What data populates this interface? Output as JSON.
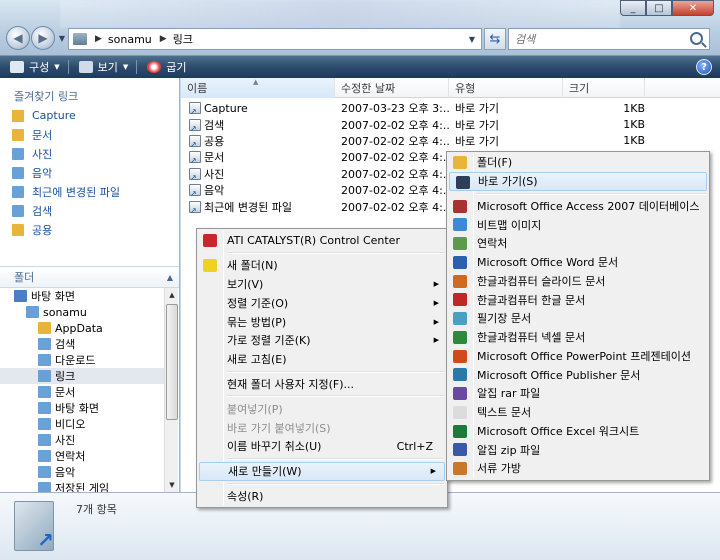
{
  "window": {
    "buttons": [
      "_",
      "□",
      "✕"
    ]
  },
  "address": {
    "crumbs": [
      "sonamu",
      "링크"
    ],
    "search_placeholder": "검색"
  },
  "toolbar": {
    "organize": "구성",
    "views": "보기",
    "burn": "굽기",
    "help": "?"
  },
  "sidebar": {
    "favorites_title": "즐겨찾기 링크",
    "favorites": [
      {
        "label": "Capture",
        "icon": "folder-icon",
        "color": "#e8b43a"
      },
      {
        "label": "문서",
        "icon": "documents-icon",
        "color": "#e8b43a"
      },
      {
        "label": "사진",
        "icon": "pictures-icon",
        "color": "#6aa0d8"
      },
      {
        "label": "음악",
        "icon": "music-icon",
        "color": "#6aa0d8"
      },
      {
        "label": "최근에 변경된 파일",
        "icon": "recent-icon",
        "color": "#6aa0d8"
      },
      {
        "label": "검색",
        "icon": "search-folder-icon",
        "color": "#6aa0d8"
      },
      {
        "label": "공용",
        "icon": "public-icon",
        "color": "#e8b43a"
      }
    ],
    "folders_title": "폴더",
    "tree": [
      {
        "label": "바탕 화면",
        "indent": 1,
        "color": "#4a7fc4"
      },
      {
        "label": "sonamu",
        "indent": 2,
        "color": "#6aa0d8"
      },
      {
        "label": "AppData",
        "indent": 3,
        "color": "#e8b43a"
      },
      {
        "label": "검색",
        "indent": 3,
        "color": "#6aa0d8"
      },
      {
        "label": "다운로드",
        "indent": 3,
        "color": "#6aa0d8"
      },
      {
        "label": "링크",
        "indent": 3,
        "color": "#6aa0d8",
        "selected": true
      },
      {
        "label": "문서",
        "indent": 3,
        "color": "#6aa0d8"
      },
      {
        "label": "바탕 화면",
        "indent": 3,
        "color": "#6aa0d8"
      },
      {
        "label": "비디오",
        "indent": 3,
        "color": "#6aa0d8"
      },
      {
        "label": "사진",
        "indent": 3,
        "color": "#6aa0d8"
      },
      {
        "label": "연락처",
        "indent": 3,
        "color": "#6aa0d8"
      },
      {
        "label": "음악",
        "indent": 3,
        "color": "#6aa0d8"
      },
      {
        "label": "저장된 게임",
        "indent": 3,
        "color": "#6aa0d8"
      }
    ]
  },
  "columns": [
    "이름",
    "수정한 날짜",
    "유형",
    "크기"
  ],
  "files": [
    {
      "name": "Capture",
      "date": "2007-03-23 오후 3:...",
      "type": "바로 가기",
      "size": "1KB"
    },
    {
      "name": "검색",
      "date": "2007-02-02 오후 4:...",
      "type": "바로 가기",
      "size": "1KB"
    },
    {
      "name": "공용",
      "date": "2007-02-02 오후 4:...",
      "type": "바로 가기",
      "size": "1KB"
    },
    {
      "name": "문서",
      "date": "2007-02-02 오후 4:...",
      "type": "",
      "size": ""
    },
    {
      "name": "사진",
      "date": "2007-02-02 오후 4:...",
      "type": "",
      "size": ""
    },
    {
      "name": "음악",
      "date": "2007-02-02 오후 4:...",
      "type": "",
      "size": ""
    },
    {
      "name": "최근에 변경된 파일",
      "date": "2007-02-02 오후 4:...",
      "type": "",
      "size": ""
    }
  ],
  "status": {
    "count": "7개 항목"
  },
  "context_menu": {
    "items": [
      {
        "label": "ATI CATALYST(R) Control Center",
        "icon": "ati-icon",
        "color": "#c8262b"
      },
      {
        "sep": true
      },
      {
        "label": "새 폴더(N)",
        "icon": "new-folder-icon",
        "color": "#f0d020"
      },
      {
        "label": "보기(V)",
        "sub": true
      },
      {
        "label": "정렬 기준(O)",
        "sub": true
      },
      {
        "label": "묶는 방법(P)",
        "sub": true
      },
      {
        "label": "가로 정렬 기준(K)",
        "sub": true
      },
      {
        "label": "새로 고침(E)"
      },
      {
        "sep": true
      },
      {
        "label": "현재 폴더 사용자 지정(F)..."
      },
      {
        "sep": true
      },
      {
        "label": "붙여넣기(P)",
        "disabled": true
      },
      {
        "label": "바로 가기 붙여넣기(S)",
        "disabled": true
      },
      {
        "label": "이름 바꾸기 취소(U)",
        "shortcut": "Ctrl+Z"
      },
      {
        "sep": true
      },
      {
        "label": "새로 만들기(W)",
        "sub": true,
        "highlight": true
      },
      {
        "sep": true
      },
      {
        "label": "속성(R)"
      }
    ]
  },
  "new_menu": {
    "items": [
      {
        "label": "폴더(F)",
        "icon": "folder-icon",
        "color": "#e8b43a"
      },
      {
        "label": "바로 가기(S)",
        "icon": "shortcut-icon",
        "color": "#2c3e5a",
        "highlight": true
      },
      {
        "sep": true
      },
      {
        "label": "Microsoft Office Access 2007 데이터베이스",
        "icon": "access-icon",
        "color": "#a83232"
      },
      {
        "label": "비트맵 이미지",
        "icon": "bitmap-icon",
        "color": "#3b8ad8"
      },
      {
        "label": "연락처",
        "icon": "contact-icon",
        "color": "#5a9a4a"
      },
      {
        "label": "Microsoft Office Word 문서",
        "icon": "word-icon",
        "color": "#2b5fb0"
      },
      {
        "label": "한글과컴퓨터 슬라이드 문서",
        "icon": "slide-icon",
        "color": "#d06a20"
      },
      {
        "label": "한글과컴퓨터 한글 문서",
        "icon": "hwp-icon",
        "color": "#c02828"
      },
      {
        "label": "필기장 문서",
        "icon": "journal-icon",
        "color": "#4aa0c0"
      },
      {
        "label": "한글과컴퓨터 넥셀 문서",
        "icon": "nexcel-icon",
        "color": "#2e8a3a"
      },
      {
        "label": "Microsoft Office PowerPoint 프레젠테이션",
        "icon": "powerpoint-icon",
        "color": "#d04a1a"
      },
      {
        "label": "Microsoft Office Publisher 문서",
        "icon": "publisher-icon",
        "color": "#2a7aa8"
      },
      {
        "label": "알집 rar 파일",
        "icon": "rar-icon",
        "color": "#6a4aa0"
      },
      {
        "label": "텍스트 문서",
        "icon": "text-icon",
        "color": "#dcdcdc"
      },
      {
        "label": "Microsoft Office Excel 워크시트",
        "icon": "excel-icon",
        "color": "#1e7a3a"
      },
      {
        "label": "알집 zip 파일",
        "icon": "zip-icon",
        "color": "#3a5aa8"
      },
      {
        "label": "서류 가방",
        "icon": "briefcase-icon",
        "color": "#c8782a"
      }
    ]
  }
}
